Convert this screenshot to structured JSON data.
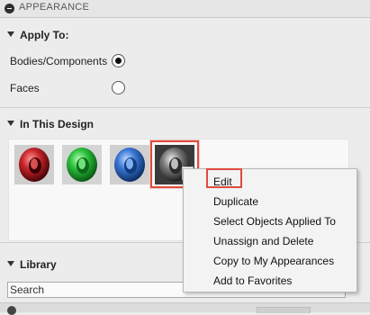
{
  "panel": {
    "title": "APPEARANCE"
  },
  "apply_to": {
    "header": "Apply To:",
    "options": [
      {
        "label": "Bodies/Components",
        "selected": true
      },
      {
        "label": "Faces",
        "selected": false
      }
    ]
  },
  "in_this_design": {
    "header": "In This Design",
    "swatches": [
      {
        "name": "red",
        "color": "#c8242a"
      },
      {
        "name": "green",
        "color": "#2bbf3c"
      },
      {
        "name": "blue",
        "color": "#3a77d3"
      },
      {
        "name": "gray",
        "color": "#6c6c6c",
        "selected": true
      }
    ]
  },
  "context_menu": {
    "items": [
      "Edit",
      "Duplicate",
      "Select Objects Applied To",
      "Unassign and Delete",
      "Copy to My Appearances",
      "Add to Favorites"
    ]
  },
  "library": {
    "header": "Library",
    "search_placeholder": "Search"
  },
  "colors": {
    "highlight": "#e04b3c"
  }
}
